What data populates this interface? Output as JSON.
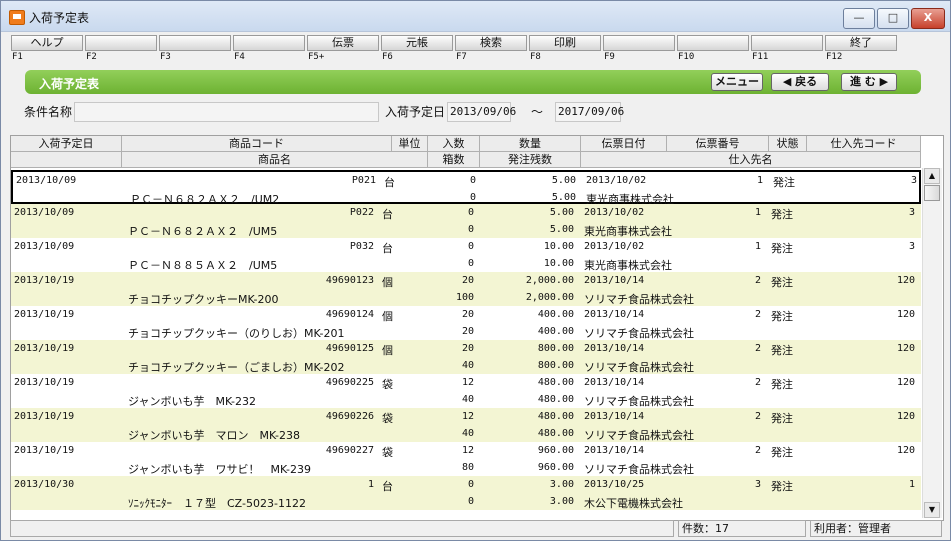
{
  "window": {
    "title": "入荷予定表",
    "minimize": "—",
    "maximize": "□",
    "close": "X"
  },
  "fkeys": [
    {
      "label": "ヘルプ",
      "key": "F1"
    },
    {
      "label": "",
      "key": "F2"
    },
    {
      "label": "",
      "key": "F3"
    },
    {
      "label": "",
      "key": "F4"
    },
    {
      "label": "伝票",
      "key": "F5+"
    },
    {
      "label": "元帳",
      "key": "F6"
    },
    {
      "label": "検索",
      "key": "F7"
    },
    {
      "label": "印刷",
      "key": "F8"
    },
    {
      "label": "",
      "key": "F9"
    },
    {
      "label": "",
      "key": "F10"
    },
    {
      "label": "",
      "key": "F11"
    },
    {
      "label": "終了",
      "key": "F12"
    }
  ],
  "header": {
    "title": "入荷予定表",
    "menu_label": "メニュー",
    "back_label": "◀ 戻る",
    "next_label": "進 む ▶"
  },
  "conditions": {
    "name_label": "条件名称",
    "name_value": "",
    "date_label": "入荷予定日",
    "date_from": "2013/09/06",
    "tilde": "～",
    "date_to": "2017/09/06"
  },
  "columns": {
    "row1": [
      "入荷予定日",
      "商品コード",
      "単位",
      "入数",
      "数量",
      "伝票日付",
      "伝票番号",
      "状態",
      "仕入先コード"
    ],
    "row2": [
      "商品名",
      "箱数",
      "発注残数",
      "仕入先名"
    ]
  },
  "rows": [
    {
      "date": "2013/10/09",
      "code": "P021",
      "unit": "台",
      "irisu": "0",
      "qty": "5.00",
      "slip_date": "2013/10/02",
      "slip_no": "1",
      "status": "発注",
      "supplier_code": "3",
      "name": "ＰＣ－Ｎ６８２ＡＸ２　/UM2",
      "hakosu": "0",
      "zan": "5.00",
      "supplier": "東光商事株式会社"
    },
    {
      "date": "2013/10/09",
      "code": "P022",
      "unit": "台",
      "irisu": "0",
      "qty": "5.00",
      "slip_date": "2013/10/02",
      "slip_no": "1",
      "status": "発注",
      "supplier_code": "3",
      "name": "ＰＣ－Ｎ６８２ＡＸ２　/UM5",
      "hakosu": "0",
      "zan": "5.00",
      "supplier": "東光商事株式会社"
    },
    {
      "date": "2013/10/09",
      "code": "P032",
      "unit": "台",
      "irisu": "0",
      "qty": "10.00",
      "slip_date": "2013/10/02",
      "slip_no": "1",
      "status": "発注",
      "supplier_code": "3",
      "name": "ＰＣ－Ｎ８８５ＡＸ２　/UM5",
      "hakosu": "0",
      "zan": "10.00",
      "supplier": "東光商事株式会社"
    },
    {
      "date": "2013/10/19",
      "code": "49690123",
      "unit": "個",
      "irisu": "20",
      "qty": "2,000.00",
      "slip_date": "2013/10/14",
      "slip_no": "2",
      "status": "発注",
      "supplier_code": "120",
      "name": "チョコチップクッキーMK-200",
      "hakosu": "100",
      "zan": "2,000.00",
      "supplier": "ソリマチ食品株式会社"
    },
    {
      "date": "2013/10/19",
      "code": "49690124",
      "unit": "個",
      "irisu": "20",
      "qty": "400.00",
      "slip_date": "2013/10/14",
      "slip_no": "2",
      "status": "発注",
      "supplier_code": "120",
      "name": "チョコチップクッキー（のりしお）MK-201",
      "hakosu": "20",
      "zan": "400.00",
      "supplier": "ソリマチ食品株式会社"
    },
    {
      "date": "2013/10/19",
      "code": "49690125",
      "unit": "個",
      "irisu": "20",
      "qty": "800.00",
      "slip_date": "2013/10/14",
      "slip_no": "2",
      "status": "発注",
      "supplier_code": "120",
      "name": "チョコチップクッキー（ごましお）MK-202",
      "hakosu": "40",
      "zan": "800.00",
      "supplier": "ソリマチ食品株式会社"
    },
    {
      "date": "2013/10/19",
      "code": "49690225",
      "unit": "袋",
      "irisu": "12",
      "qty": "480.00",
      "slip_date": "2013/10/14",
      "slip_no": "2",
      "status": "発注",
      "supplier_code": "120",
      "name": "ジャンボいも芋　MK-232",
      "hakosu": "40",
      "zan": "480.00",
      "supplier": "ソリマチ食品株式会社"
    },
    {
      "date": "2013/10/19",
      "code": "49690226",
      "unit": "袋",
      "irisu": "12",
      "qty": "480.00",
      "slip_date": "2013/10/14",
      "slip_no": "2",
      "status": "発注",
      "supplier_code": "120",
      "name": "ジャンボいも芋　マロン　MK-238",
      "hakosu": "40",
      "zan": "480.00",
      "supplier": "ソリマチ食品株式会社"
    },
    {
      "date": "2013/10/19",
      "code": "49690227",
      "unit": "袋",
      "irisu": "12",
      "qty": "960.00",
      "slip_date": "2013/10/14",
      "slip_no": "2",
      "status": "発注",
      "supplier_code": "120",
      "name": "ジャンボいも芋　ワサビ！　MK-239",
      "hakosu": "80",
      "zan": "960.00",
      "supplier": "ソリマチ食品株式会社"
    },
    {
      "date": "2013/10/30",
      "code": "1",
      "unit": "台",
      "irisu": "0",
      "qty": "3.00",
      "slip_date": "2013/10/25",
      "slip_no": "3",
      "status": "発注",
      "supplier_code": "1",
      "name": "ｿﾆｯｸﾓﾆﾀｰ　１７型　CZ-5023-1122",
      "hakosu": "0",
      "zan": "3.00",
      "supplier": "木公下電機株式会社"
    }
  ],
  "status": {
    "count": "件数：17",
    "user": "利用者：管理者"
  },
  "colors": {
    "accent_green": "#7dc243",
    "alt_row": "#f3f5d3"
  }
}
